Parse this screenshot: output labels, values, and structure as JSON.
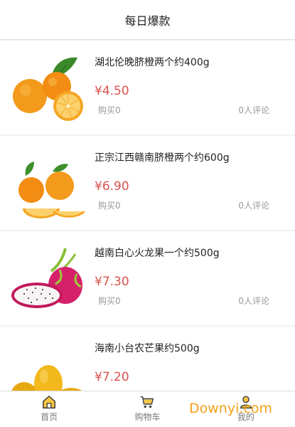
{
  "header": {
    "title": "每日爆款"
  },
  "products": [
    {
      "name": "湖北伦晚脐橙两个约400g",
      "price": "¥4.50",
      "bought": "购买0",
      "comments": "0人评论",
      "image": "oranges-with-leaves"
    },
    {
      "name": "正宗江西赣南脐橙两个约600g",
      "price": "¥6.90",
      "bought": "购买0",
      "comments": "0人评论",
      "image": "sliced-oranges"
    },
    {
      "name": "越南白心火龙果一个约500g",
      "price": "¥7.30",
      "bought": "购买0",
      "comments": "0人评论",
      "image": "dragon-fruit"
    },
    {
      "name": "海南小台农芒果约500g",
      "price": "¥7.20",
      "bought": "",
      "comments": "",
      "image": "mangoes"
    }
  ],
  "tabbar": {
    "tabs": [
      {
        "label": "首页",
        "icon": "home-icon",
        "active": true
      },
      {
        "label": "购物车",
        "icon": "cart-icon",
        "active": false
      },
      {
        "label": "我的",
        "icon": "user-icon",
        "active": false
      }
    ]
  },
  "watermark": "Downyi.com",
  "colors": {
    "price": "#d9534f",
    "accent": "#f0a21a",
    "text_muted": "#999999"
  }
}
